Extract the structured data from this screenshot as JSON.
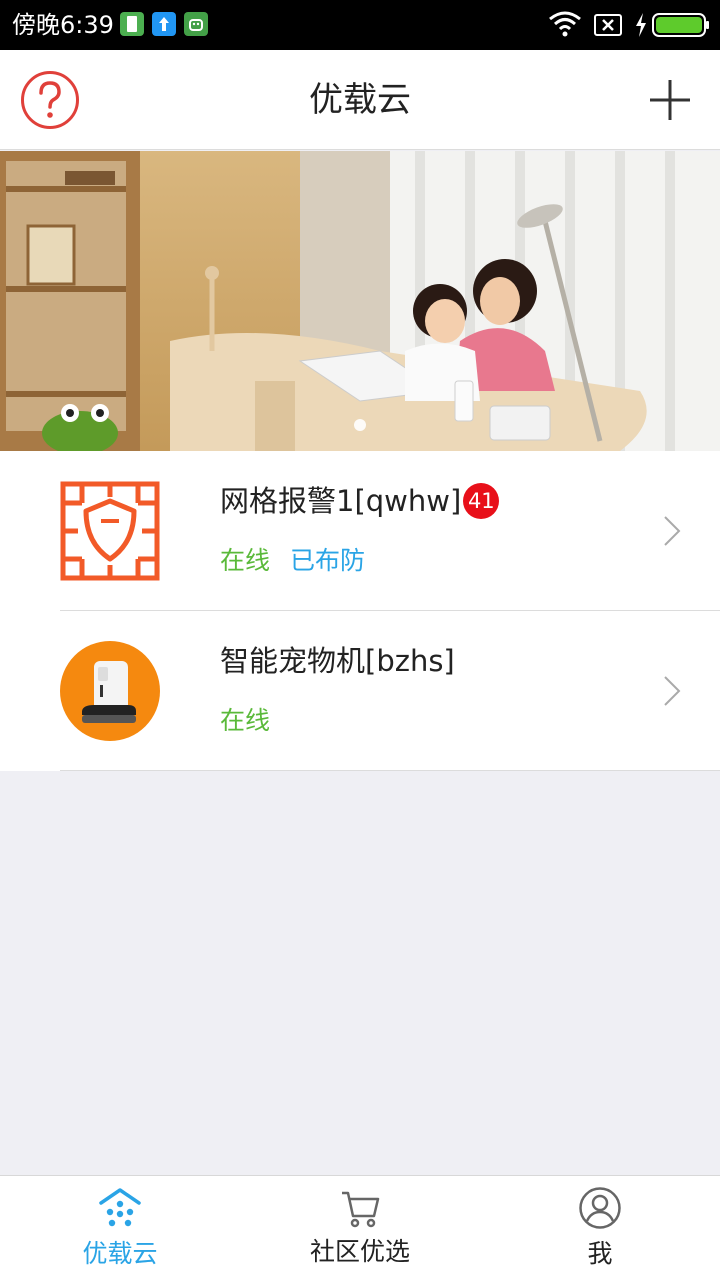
{
  "status_bar": {
    "time": "傍晚6:39",
    "icons": [
      "sim-card-icon",
      "upload-icon",
      "android-icon",
      "wifi-icon",
      "no-sim-icon",
      "charging-icon",
      "battery-icon"
    ]
  },
  "header": {
    "title": "优载云",
    "help_icon": "question-icon",
    "add_icon": "plus-icon"
  },
  "banner": {
    "slide_count_visible": 1,
    "active_index": 0
  },
  "devices": [
    {
      "name": "网格报警1[qwhw]",
      "badge": "41",
      "status": "在线",
      "arm_status": "已布防",
      "icon": "grid-alarm-shield-icon"
    },
    {
      "name": "智能宠物机[bzhs]",
      "status": "在线",
      "icon": "pet-feeder-icon"
    }
  ],
  "bottom_nav": {
    "items": [
      {
        "label": "优载云",
        "icon": "home-cloud-icon",
        "active": true
      },
      {
        "label": "社区优选",
        "icon": "cart-icon",
        "active": false
      },
      {
        "label": "我",
        "icon": "user-icon",
        "active": false
      }
    ]
  },
  "colors": {
    "accent": "#2aa4e6",
    "online": "#5ab93a",
    "badge": "#e8101a",
    "alarm_orange": "#f25a28",
    "feeder_orange": "#f5890f"
  }
}
